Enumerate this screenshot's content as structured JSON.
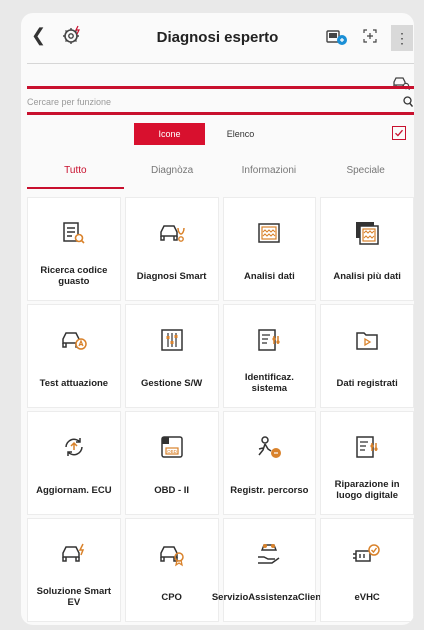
{
  "header": {
    "title": "Diagnosi esperto",
    "back_icon": "back-arrow-icon",
    "more_icon": "kebab-menu-icon",
    "accent": "#c8102e"
  },
  "search": {
    "placeholder": "Cercare per funzione"
  },
  "view_toggle": {
    "icons_label": "Icone",
    "list_label": "Elenco",
    "active": "Icone"
  },
  "tabs": [
    {
      "label": "Tutto",
      "active": true
    },
    {
      "label": "Diagnòza",
      "active": false
    },
    {
      "label": "Informazioni",
      "active": false
    },
    {
      "label": "Speciale",
      "active": false
    }
  ],
  "functions": [
    {
      "label": "Ricerca codice guasto",
      "icon": "fault-code-search-icon"
    },
    {
      "label": "Diagnosi Smart",
      "icon": "smart-diagnosis-icon"
    },
    {
      "label": "Analisi dati",
      "icon": "data-analysis-icon"
    },
    {
      "label": "Analisi più dati",
      "icon": "multi-data-analysis-icon"
    },
    {
      "label": "Test attuazione",
      "icon": "actuation-test-icon"
    },
    {
      "label": "Gestione S/W",
      "icon": "software-management-icon"
    },
    {
      "label": "Identificaz. sistema",
      "icon": "system-identification-icon"
    },
    {
      "label": "Dati registrati",
      "icon": "recorded-data-icon"
    },
    {
      "label": "Aggiornam. ECU",
      "icon": "ecu-update-icon"
    },
    {
      "label": "OBD - II",
      "icon": "obd-icon"
    },
    {
      "label": "Registr. percorso",
      "icon": "route-recording-icon"
    },
    {
      "label": "Riparazione in luogo digitale",
      "icon": "digital-repair-icon"
    },
    {
      "label": "Soluzione Smart EV",
      "icon": "smart-ev-icon"
    },
    {
      "label": "CPO",
      "icon": "cpo-icon"
    },
    {
      "label": "ServizioAssistenzaClienti",
      "icon": "customer-service-icon"
    },
    {
      "label": "eVHC",
      "icon": "evhc-icon"
    }
  ]
}
